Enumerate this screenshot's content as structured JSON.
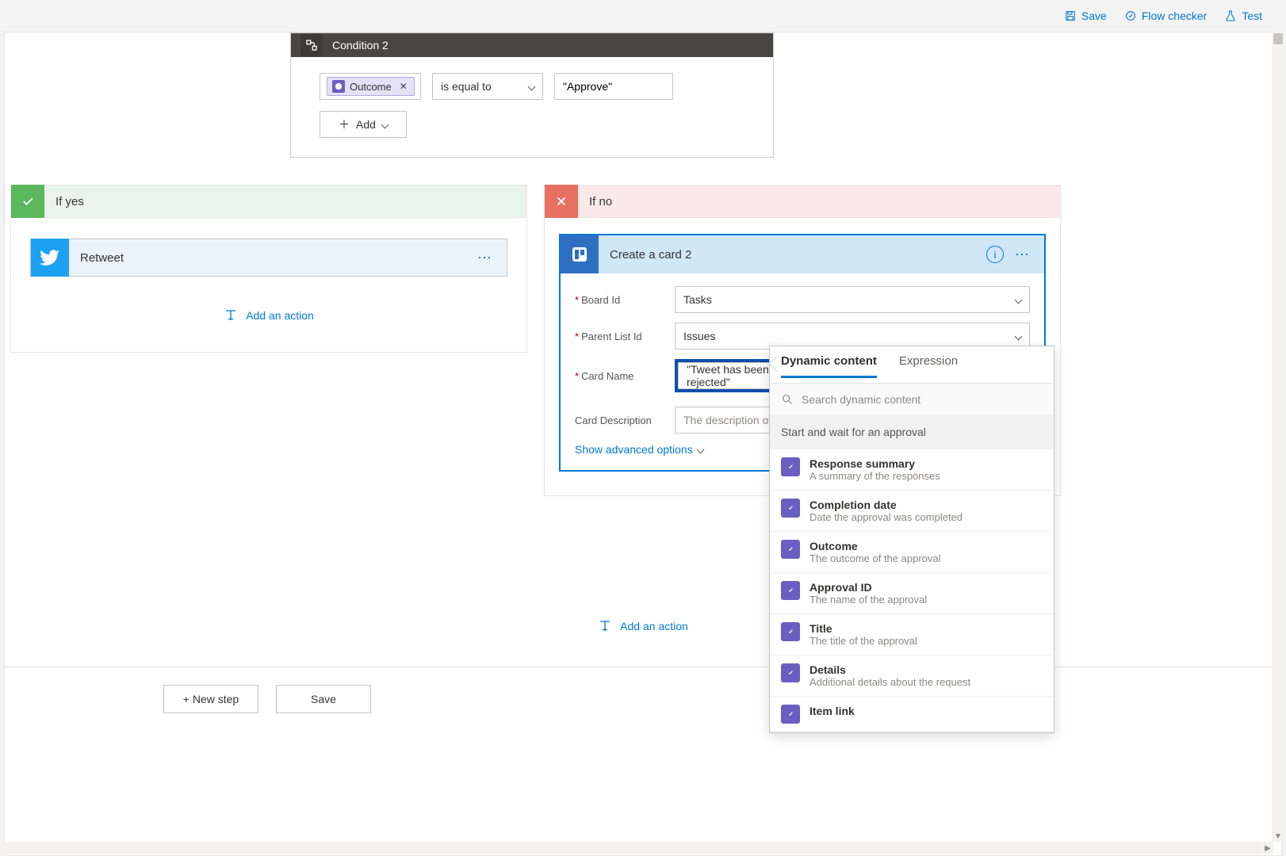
{
  "topbar": {
    "save": "Save",
    "flow_checker": "Flow checker",
    "test": "Test"
  },
  "condition": {
    "title": "Condition 2",
    "token": "Outcome",
    "operator": "is equal to",
    "value": "\"Approve\"",
    "add_label": "Add"
  },
  "branches": {
    "yes": {
      "title": "If yes",
      "action": {
        "title": "Retweet"
      },
      "add_action": "Add an action"
    },
    "no": {
      "title": "If no",
      "card": {
        "title": "Create a card 2",
        "fields": {
          "board_id": {
            "label": "Board Id",
            "value": "Tasks"
          },
          "parent_list_id": {
            "label": "Parent List Id",
            "value": "Issues"
          },
          "card_name": {
            "label": "Card Name",
            "value": "\"Tweet has been rejected\""
          },
          "card_description": {
            "label": "Card Description",
            "placeholder": "The description of the"
          }
        },
        "advanced": "Show advanced options"
      }
    }
  },
  "dynamic_panel": {
    "tabs": {
      "dynamic": "Dynamic content",
      "expression": "Expression"
    },
    "search_placeholder": "Search dynamic content",
    "section": "Start and wait for an approval",
    "items": [
      {
        "title": "Response summary",
        "desc": "A summary of the responses"
      },
      {
        "title": "Completion date",
        "desc": "Date the approval was completed"
      },
      {
        "title": "Outcome",
        "desc": "The outcome of the approval"
      },
      {
        "title": "Approval ID",
        "desc": "The name of the approval"
      },
      {
        "title": "Title",
        "desc": "The title of the approval"
      },
      {
        "title": "Details",
        "desc": "Additional details about the request"
      },
      {
        "title": "Item link",
        "desc": ""
      }
    ]
  },
  "outer_add_action": "Add an action",
  "bottom": {
    "new_step": "+ New step",
    "save": "Save"
  }
}
